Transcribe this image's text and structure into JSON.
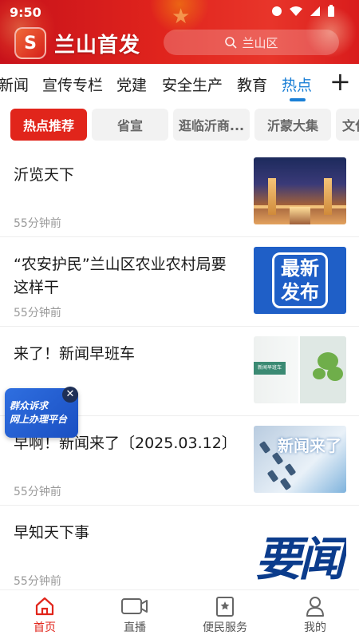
{
  "status_bar": {
    "time": "9:50"
  },
  "header": {
    "app_name": "兰山首发",
    "logo_glyph": "S",
    "search_placeholder": "兰山区",
    "accent_color": "#e1251b"
  },
  "tabs": [
    {
      "label": "新闻",
      "active": false
    },
    {
      "label": "宣传专栏",
      "active": false
    },
    {
      "label": "党建",
      "active": false
    },
    {
      "label": "安全生产",
      "active": false
    },
    {
      "label": "教育",
      "active": false
    },
    {
      "label": "热点",
      "active": true
    }
  ],
  "add_tab_symbol": "+",
  "chips": [
    {
      "label": "热点推荐",
      "active": true
    },
    {
      "label": "省宣",
      "active": false
    },
    {
      "label": "逛临沂商...",
      "active": false
    },
    {
      "label": "沂蒙大集",
      "active": false
    },
    {
      "label": "文化",
      "active": false
    }
  ],
  "articles": [
    {
      "title": "沂览天下",
      "time": "55分钟前"
    },
    {
      "title": "“农安护民”兰山区农业农村局要这样干",
      "time": "55分钟前",
      "thumb_text_1": "最新",
      "thumb_text_2": "发布"
    },
    {
      "title": "来了！新闻早班车",
      "time": "",
      "thumb_sign": "新闻早班车"
    },
    {
      "title": "早啊！新闻来了〔2025.03.12〕",
      "time": "55分钟前",
      "thumb_text": "新闻来了"
    },
    {
      "title": "早知天下事",
      "time": "55分钟前",
      "thumb_text": "要闻"
    }
  ],
  "float_banner": {
    "line1": "群众诉求",
    "line2": "网上办理平台",
    "close_symbol": "✕"
  },
  "bottom_nav": [
    {
      "label": "首页",
      "icon": "home-icon",
      "active": true
    },
    {
      "label": "直播",
      "icon": "video-icon",
      "active": false
    },
    {
      "label": "便民服务",
      "icon": "service-icon",
      "active": false
    },
    {
      "label": "我的",
      "icon": "profile-icon",
      "active": false
    }
  ]
}
